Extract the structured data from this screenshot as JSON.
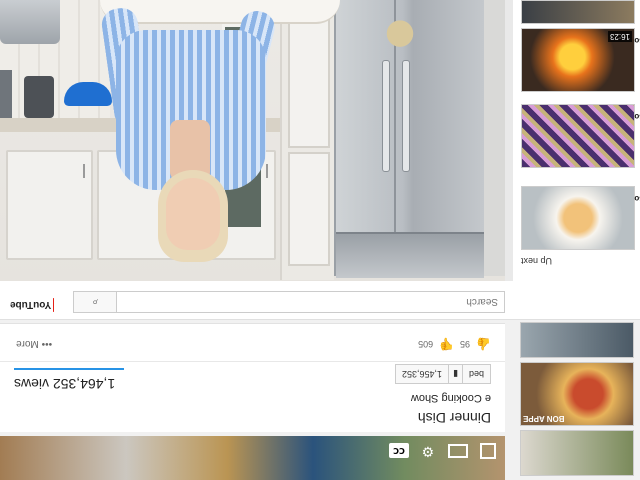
{
  "app": {
    "name": "YouTube"
  },
  "video": {
    "title": "Dinner Dish",
    "channel": "e Cooking Show",
    "views": "1,464,352 views",
    "subscribe_label": "bed",
    "subscriber_count": "1,456,352",
    "more_label": "••• More",
    "like_count": "95",
    "dislike_count": "605"
  },
  "search": {
    "placeholder": "Search"
  },
  "sidebar": {
    "up_next_label": "Up next",
    "items": [
      {
        "duration": "16:23",
        "meta": "Bo"
      },
      {
        "duration": "",
        "meta": "Bo"
      },
      {
        "duration": "",
        "meta": "Bo"
      }
    ]
  },
  "sidebar_lower": {
    "items": [
      {
        "label": "BON APPE"
      },
      {
        "label": ""
      },
      {
        "label": ""
      }
    ]
  },
  "colors": {
    "brand_red": "#e62117",
    "link_blue": "#2793e6"
  }
}
